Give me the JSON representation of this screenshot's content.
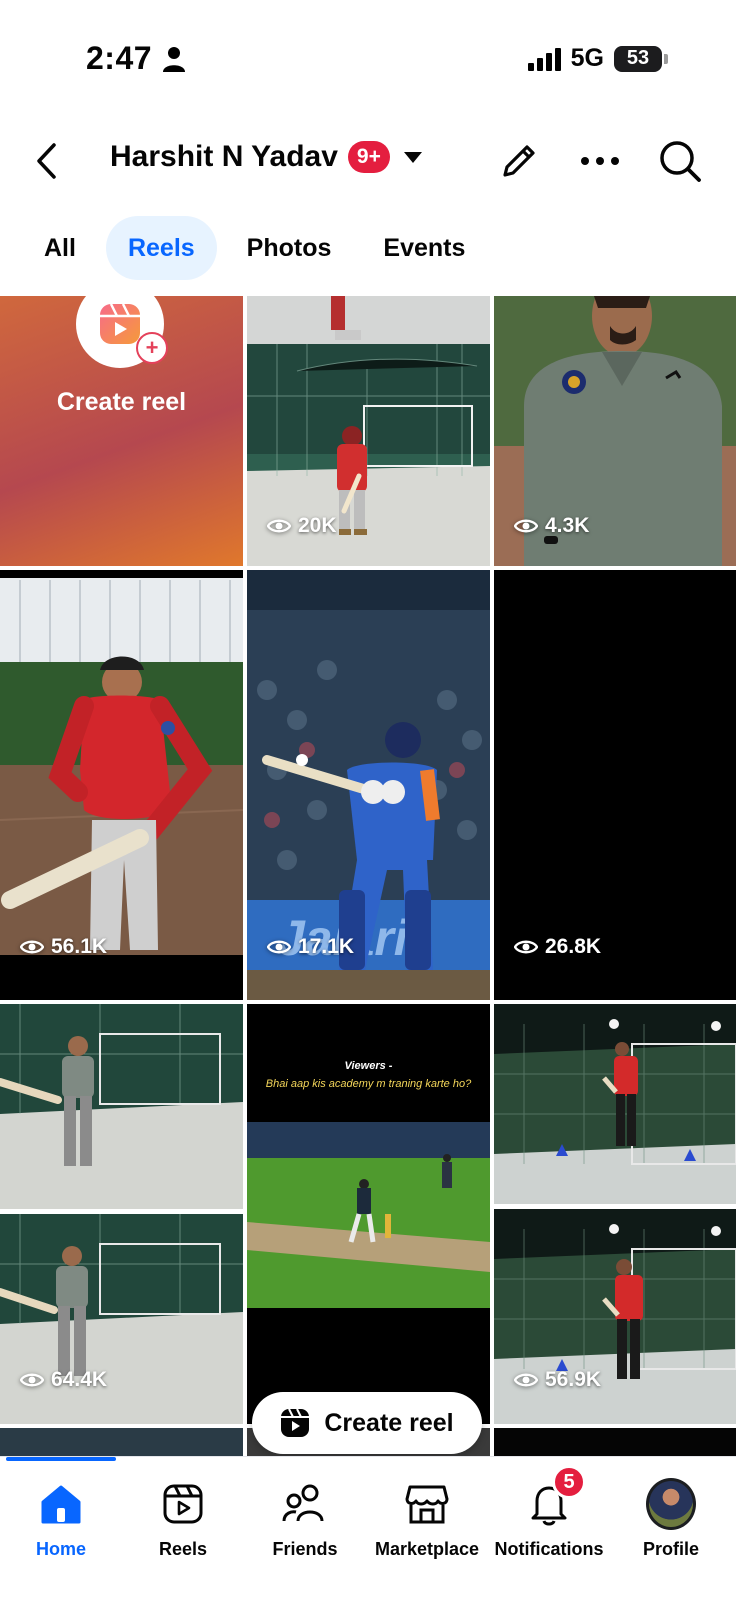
{
  "status_bar": {
    "time": "2:47",
    "network": "5G",
    "battery": "53",
    "battery_level": 0.53
  },
  "header": {
    "title": "Harshit N Yadav",
    "badge": "9+",
    "icons": [
      "back-arrow-icon",
      "chevron-down-icon",
      "pencil-icon",
      "more-icon",
      "search-icon"
    ]
  },
  "tabs": [
    {
      "label": "All",
      "active": false
    },
    {
      "label": "Reels",
      "active": true
    },
    {
      "label": "Photos",
      "active": false
    },
    {
      "label": "Events",
      "active": false
    }
  ],
  "create_tile": {
    "label": "Create reel"
  },
  "reels": [
    {
      "views": "20K",
      "scene": "net-practice-batting"
    },
    {
      "views": "4.3K",
      "scene": "player-talking-green-shirt"
    },
    {
      "views": "56.1K",
      "scene": "player-holding-bat-red-jacket"
    },
    {
      "views": "17.1K",
      "scene": "india-batter-blue-kit"
    },
    {
      "views": "26.8K",
      "scene": "black-screen"
    },
    {
      "views": "64.4K",
      "scene": "net-practice-grey-shirt"
    },
    {
      "views": "",
      "scene": "night-match-ground",
      "caption_line1": "Viewers -",
      "caption_line2": "Bhai aap kis academy m traning karte ho?"
    },
    {
      "views": "56.9K",
      "scene": "night-net-red-jacket"
    }
  ],
  "floating_button": {
    "label": "Create reel"
  },
  "bottom_nav": [
    {
      "label": "Home",
      "icon": "home-icon",
      "active": true
    },
    {
      "label": "Reels",
      "icon": "reels-icon",
      "active": false
    },
    {
      "label": "Friends",
      "icon": "friends-icon",
      "active": false
    },
    {
      "label": "Marketplace",
      "icon": "marketplace-icon",
      "active": false
    },
    {
      "label": "Notifications",
      "icon": "bell-icon",
      "active": false,
      "badge": "5"
    },
    {
      "label": "Profile",
      "icon": "avatar",
      "active": false
    }
  ],
  "colors": {
    "accent": "#0866ff",
    "badge": "#e41e3f",
    "tab_active_bg": "#e7f3ff"
  }
}
